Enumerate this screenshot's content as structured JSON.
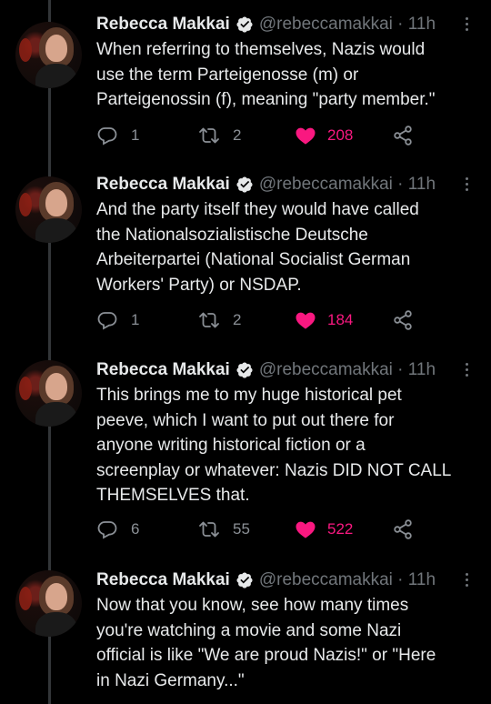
{
  "colors": {
    "background": "#000000",
    "text": "#e7e9ea",
    "secondary": "#71767b",
    "like_pink": "#f91880",
    "verified_fill": "#e7e9ea"
  },
  "icons": {
    "verified": "verified-badge-icon",
    "more": "more-vertical-icon",
    "reply": "reply-bubble-icon",
    "retweet": "retweet-icon",
    "like": "heart-filled-icon",
    "share": "share-icon"
  },
  "tweets": [
    {
      "author_name": "Rebecca Makkai",
      "handle_time": "@rebeccamakkai · 11h",
      "lines": [
        "When referring to themselves, Nazis would",
        "use the term Parteigenosse (m) or",
        "Parteigenossin (f), meaning \"party member.\""
      ],
      "replies": "1",
      "retweets": "2",
      "likes": "208"
    },
    {
      "author_name": "Rebecca Makkai",
      "handle_time": "@rebeccamakkai · 11h",
      "lines": [
        "And the party itself they would have called",
        "the Nationalsozialistische Deutsche",
        "Arbeiterpartei (National Socialist German",
        "Workers' Party) or NSDAP."
      ],
      "replies": "1",
      "retweets": "2",
      "likes": "184"
    },
    {
      "author_name": "Rebecca Makkai",
      "handle_time": "@rebeccamakkai · 11h",
      "lines": [
        "This brings me to my huge historical pet",
        "peeve, which I want to put out there for",
        "anyone writing historical fiction or a",
        "screenplay or whatever: Nazis DID NOT CALL",
        "THEMSELVES that."
      ],
      "replies": "6",
      "retweets": "55",
      "likes": "522"
    },
    {
      "author_name": "Rebecca Makkai",
      "handle_time": "@rebeccamakkai · 11h",
      "lines": [
        "Now that you know, see how many times",
        "you're watching a movie and some Nazi",
        "official is like \"We are proud Nazis!\" or \"Here",
        "in Nazi Germany...\""
      ]
    }
  ]
}
